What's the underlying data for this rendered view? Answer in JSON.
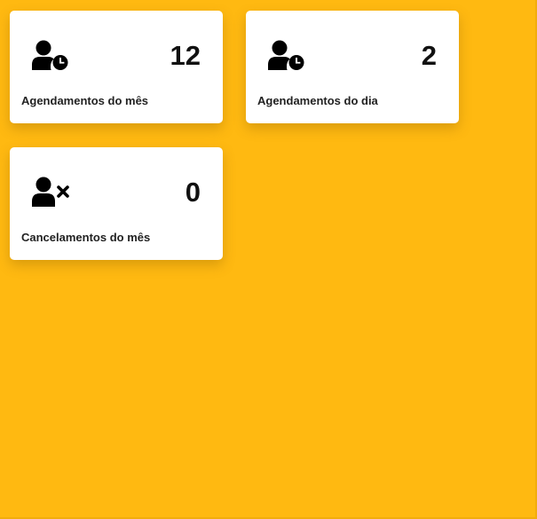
{
  "theme": {
    "background": "#FFB911",
    "card_background": "#FFFFFF",
    "text_color": "#111111"
  },
  "cards": [
    {
      "icon": "user-clock-icon",
      "count": "12",
      "label": "Agendamentos do mês"
    },
    {
      "icon": "user-clock-icon",
      "count": "2",
      "label": "Agendamentos do dia"
    },
    {
      "icon": "user-times-icon",
      "count": "0",
      "label": "Cancelamentos do mês"
    }
  ]
}
